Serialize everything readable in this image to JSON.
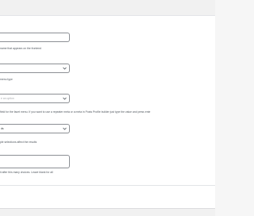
{
  "fields": {
    "label_input": {
      "value": ""
    },
    "label_help": "name that appears on the frontend",
    "menu_type_select": {
      "value": ""
    },
    "menu_type_label": "menu type",
    "source_select": {
      "placeholder": "e an option"
    },
    "source_help": "field for the facet menu. If you want to use a repeater meta or a meta in Posts Profile builder just type the value and press ente",
    "logic_select": {
      "value": "ds"
    },
    "logic_help": "ple selections affect the results",
    "textarea": {
      "value": ""
    },
    "textarea_help": "it after this many choices. Leave blank for all"
  },
  "icons": {
    "select_arrow": "chevron-down-icon"
  },
  "colors": {
    "border": "#8c8f94",
    "text": "#50575e",
    "placeholder": "#a7aaad",
    "panel": "#ffffff",
    "chrome": "#f1f1f1"
  }
}
